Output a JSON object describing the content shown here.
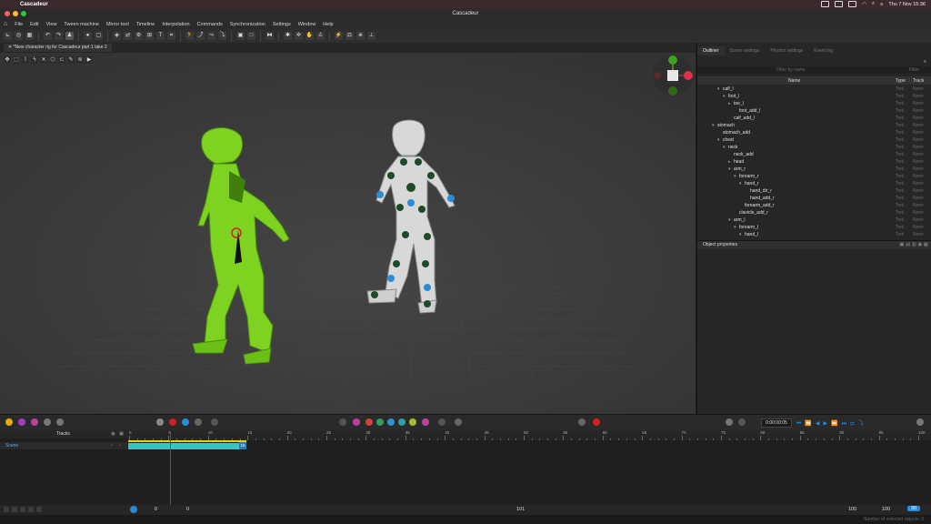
{
  "menubar": {
    "app_name": "Cascadeur",
    "clock": "Thu 7 Nov  15:36"
  },
  "window": {
    "title": "Cascadeur",
    "tab": "*New character rig for Cascadeur part 1 take 2"
  },
  "app_menu": [
    "File",
    "Edit",
    "View",
    "Tween machine",
    "Mirror tool",
    "Timeline",
    "Interpolation",
    "Commands",
    "Synchronization",
    "Settings",
    "Window",
    "Help"
  ],
  "right_panel": {
    "tabs": [
      "Outliner",
      "Scene settings",
      "Physics settings",
      "Event log"
    ],
    "filter_placeholder": "Filter by name",
    "filter_button": "Filter",
    "columns": {
      "name": "Name",
      "type": "Type",
      "track": "Track"
    },
    "rows": [
      {
        "name": "calf_l",
        "level": 3,
        "arrow": "▾",
        "type": "Tool",
        "track": "None"
      },
      {
        "name": "foot_l",
        "level": 4,
        "arrow": "▾",
        "type": "Tool",
        "track": "None"
      },
      {
        "name": "toe_l",
        "level": 5,
        "arrow": "▸",
        "type": "Tool",
        "track": "None"
      },
      {
        "name": "foot_add_l",
        "level": 6,
        "arrow": "",
        "type": "Tool",
        "track": "None"
      },
      {
        "name": "calf_add_l",
        "level": 5,
        "arrow": "",
        "type": "Tool",
        "track": "None"
      },
      {
        "name": "stomach",
        "level": 2,
        "arrow": "▾",
        "type": "Tool",
        "track": "None"
      },
      {
        "name": "stomach_add",
        "level": 3,
        "arrow": "",
        "type": "Tool",
        "track": "None"
      },
      {
        "name": "chest",
        "level": 3,
        "arrow": "▾",
        "type": "Tool",
        "track": "None"
      },
      {
        "name": "neck",
        "level": 4,
        "arrow": "▾",
        "type": "Tool",
        "track": "None"
      },
      {
        "name": "neck_add",
        "level": 5,
        "arrow": "",
        "type": "Tool",
        "track": "None"
      },
      {
        "name": "head",
        "level": 5,
        "arrow": "▸",
        "type": "Tool",
        "track": "None"
      },
      {
        "name": "arm_r",
        "level": 5,
        "arrow": "▾",
        "type": "Tool",
        "track": "None"
      },
      {
        "name": "forearm_r",
        "level": 6,
        "arrow": "▾",
        "type": "Tool",
        "track": "None"
      },
      {
        "name": "hand_r",
        "level": 7,
        "arrow": "▾",
        "type": "Tool",
        "track": "None"
      },
      {
        "name": "hand_dir_r",
        "level": 8,
        "arrow": "",
        "type": "Tool",
        "track": "None"
      },
      {
        "name": "hand_add_r",
        "level": 8,
        "arrow": "",
        "type": "Tool",
        "track": "None"
      },
      {
        "name": "forearm_add_r",
        "level": 7,
        "arrow": "",
        "type": "Tool",
        "track": "None"
      },
      {
        "name": "clavicle_add_r",
        "level": 6,
        "arrow": "",
        "type": "Tool",
        "track": "None"
      },
      {
        "name": "arm_l",
        "level": 5,
        "arrow": "▾",
        "type": "Tool",
        "track": "None"
      },
      {
        "name": "forearm_l",
        "level": 6,
        "arrow": "▾",
        "type": "Tool",
        "track": "None"
      },
      {
        "name": "hand_l",
        "level": 7,
        "arrow": "▾",
        "type": "Tool",
        "track": "None"
      }
    ],
    "object_properties": "Object properties"
  },
  "timeline": {
    "timecode": "0:00:00:05",
    "tracks_label": "Tracks",
    "scene_label": "Scene",
    "ruler_ticks": [
      "0",
      "5",
      "10",
      "15",
      "20",
      "25",
      "30",
      "35",
      "40",
      "45",
      "50",
      "55",
      "60",
      "65",
      "70",
      "75",
      "80",
      "85",
      "90",
      "95",
      "100"
    ],
    "clip_end_frame": "15",
    "bottom": {
      "current_frame": "0",
      "start": "0",
      "middle": "101",
      "end_a": "100",
      "end_b": "100",
      "fps": "30"
    }
  },
  "status": "Number of selected objects: 0",
  "colors": {
    "accent": "#2b7fb0",
    "green_char": "#7ed321",
    "clip": "#3ec2c0",
    "range": "#e6d400",
    "playhead": "#d02020"
  }
}
